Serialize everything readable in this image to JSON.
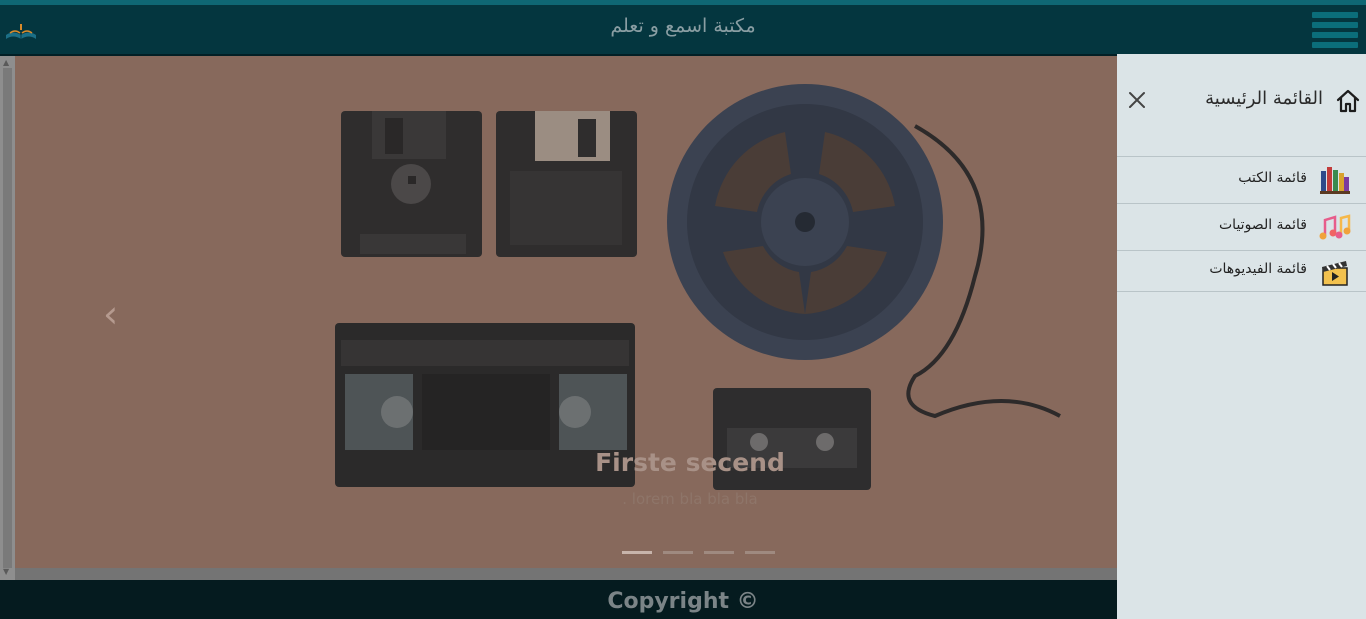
{
  "navbar": {
    "title": "مكتبة اسمع و تعلم",
    "logo_icon": "open-book-logo",
    "menu_icon": "hamburger-icon"
  },
  "carousel": {
    "caption_title": "Firste secend",
    "caption_text": ". lorem bla bla bla",
    "prev_icon": "chevron-left-icon",
    "slides_count": 4,
    "active_slide": 1
  },
  "footer": {
    "text": "Copyright ©"
  },
  "sidenav": {
    "header_label": "القائمة الرئيسية",
    "header_icon": "home-icon",
    "close_icon": "close-icon",
    "items": [
      {
        "label": "قائمة الكتب",
        "icon": "books-icon"
      },
      {
        "label": "قائمة الصوتيات",
        "icon": "music-notes-icon"
      },
      {
        "label": "قائمة الفيديوهات",
        "icon": "clapperboard-icon"
      }
    ]
  },
  "colors": {
    "navbar": "#04363f",
    "accent": "#0b6e7b",
    "sidenav": "#dbe4e7",
    "footer": "#051b1f"
  }
}
